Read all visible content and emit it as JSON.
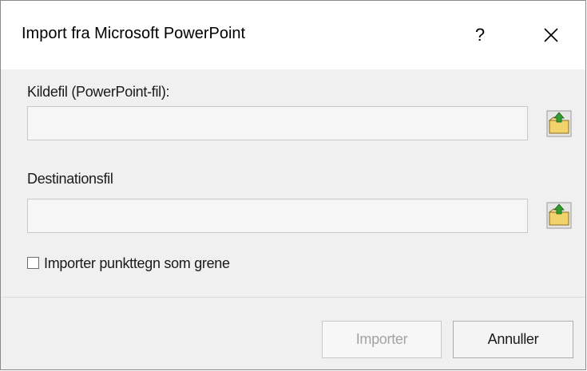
{
  "dialog": {
    "title": "Import fra Microsoft PowerPoint",
    "help_label": "?",
    "close_icon": "close-icon"
  },
  "source": {
    "label": "Kildefil (PowerPoint-fil):",
    "value": "",
    "browse_icon": "folder-open-icon"
  },
  "destination": {
    "label": "Destinationsfil",
    "value": "",
    "browse_icon": "folder-open-icon"
  },
  "options": {
    "import_bullets_label": "Importer punkttegn som grene",
    "import_bullets_checked": false
  },
  "buttons": {
    "import_label": "Importer",
    "import_enabled": false,
    "cancel_label": "Annuller"
  },
  "colors": {
    "dialog_background": "#f0f0f0",
    "folder_yellow": "#f2d36b",
    "arrow_green": "#2f9e2f"
  }
}
